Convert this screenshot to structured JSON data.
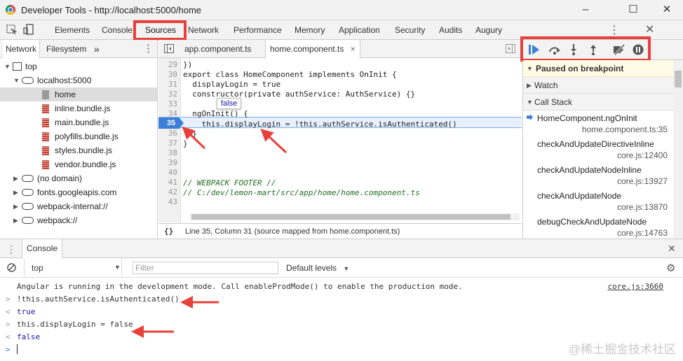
{
  "window": {
    "title": "Developer Tools - http://localhost:5000/home",
    "controls": [
      "–",
      "☐",
      "✕"
    ]
  },
  "devtools_tabs": [
    "Elements",
    "Console",
    "Sources",
    "Network",
    "Performance",
    "Memory",
    "Application",
    "Security",
    "Audits",
    "Augury"
  ],
  "active_tab": "Sources",
  "navigator": {
    "tabs": [
      "Network",
      "Filesystem"
    ],
    "more": "»",
    "tree": [
      {
        "label": "top",
        "level": 0,
        "kind": "frame",
        "expanded": true
      },
      {
        "label": "localhost:5000",
        "level": 1,
        "kind": "cloud",
        "expanded": true
      },
      {
        "label": "home",
        "level": 2,
        "kind": "file-gray",
        "selected": true
      },
      {
        "label": "inline.bundle.js",
        "level": 2,
        "kind": "file-js"
      },
      {
        "label": "main.bundle.js",
        "level": 2,
        "kind": "file-js"
      },
      {
        "label": "polyfills.bundle.js",
        "level": 2,
        "kind": "file-js"
      },
      {
        "label": "styles.bundle.js",
        "level": 2,
        "kind": "file-js"
      },
      {
        "label": "vendor.bundle.js",
        "level": 2,
        "kind": "file-js"
      },
      {
        "label": "(no domain)",
        "level": 1,
        "kind": "cloud",
        "expanded": false
      },
      {
        "label": "fonts.googleapis.com",
        "level": 1,
        "kind": "cloud",
        "expanded": false
      },
      {
        "label": "webpack-internal://",
        "level": 1,
        "kind": "cloud",
        "expanded": false
      },
      {
        "label": "webpack://",
        "level": 1,
        "kind": "cloud",
        "expanded": false
      }
    ]
  },
  "editor": {
    "tabs": [
      {
        "label": "app.component.ts",
        "active": false
      },
      {
        "label": "home.component.ts",
        "active": true,
        "close": "×"
      }
    ],
    "lines": [
      {
        "num": "29",
        "text": "})"
      },
      {
        "num": "30",
        "text": "export class HomeComponent implements OnInit {"
      },
      {
        "num": "31",
        "text": "  displayLogin = true"
      },
      {
        "num": "32",
        "text": "  constructor(private authService: AuthService) {}"
      },
      {
        "num": "33",
        "text": ""
      },
      {
        "num": "34",
        "text": "  ngOnInit() {"
      },
      {
        "num": "35",
        "text": "    this.displayLogin = !this.authService.isAuthenticated()"
      },
      {
        "num": "36",
        "text": "  }"
      },
      {
        "num": "37",
        "text": "}"
      },
      {
        "num": "38",
        "text": ""
      },
      {
        "num": "39",
        "text": ""
      },
      {
        "num": "40",
        "text": ""
      },
      {
        "num": "41",
        "text": "// WEBPACK FOOTER //"
      },
      {
        "num": "42",
        "text": "// C:/dev/lemon-mart/src/app/home/home.component.ts"
      },
      {
        "num": "43",
        "text": ""
      }
    ],
    "tooltip": "false",
    "status": "Line 35, Column 31   (source mapped from home.component.ts)",
    "status_icon": "{}"
  },
  "debugger": {
    "paused_label": "Paused on breakpoint",
    "watch_label": "Watch",
    "callstack_label": "Call Stack",
    "callstack": [
      {
        "fn": "HomeComponent.ngOnInit",
        "loc": "home.component.ts:35",
        "current": true
      },
      {
        "fn": "checkAndUpdateDirectiveInline",
        "loc": "core.js:12400"
      },
      {
        "fn": "checkAndUpdateNodeInline",
        "loc": "core.js:13927"
      },
      {
        "fn": "checkAndUpdateNode",
        "loc": "core.js:13870"
      },
      {
        "fn": "debugCheckAndUpdateNode",
        "loc": "core.js:14763"
      }
    ]
  },
  "console": {
    "tab": "Console",
    "context": "top",
    "filter_placeholder": "Filter",
    "levels": "Default levels",
    "lines": [
      {
        "prefix": "",
        "text": "Angular is running in the development mode. Call enableProdMode() to enable the production mode.",
        "source": "core.js:3660",
        "kind": "log"
      },
      {
        "prefix": ">",
        "text": "!this.authService.isAuthenticated()",
        "kind": "input"
      },
      {
        "prefix": "<",
        "text": "true",
        "kind": "result"
      },
      {
        "prefix": ">",
        "text": "this.displayLogin = false",
        "kind": "input"
      },
      {
        "prefix": "<",
        "text": "false",
        "kind": "result"
      },
      {
        "prefix": ">",
        "text": "",
        "kind": "prompt"
      }
    ]
  },
  "watermark": "@稀土掘金技术社区",
  "colors": {
    "highlight_red": "#e8403a",
    "exec_blue": "#3b7fd8"
  }
}
